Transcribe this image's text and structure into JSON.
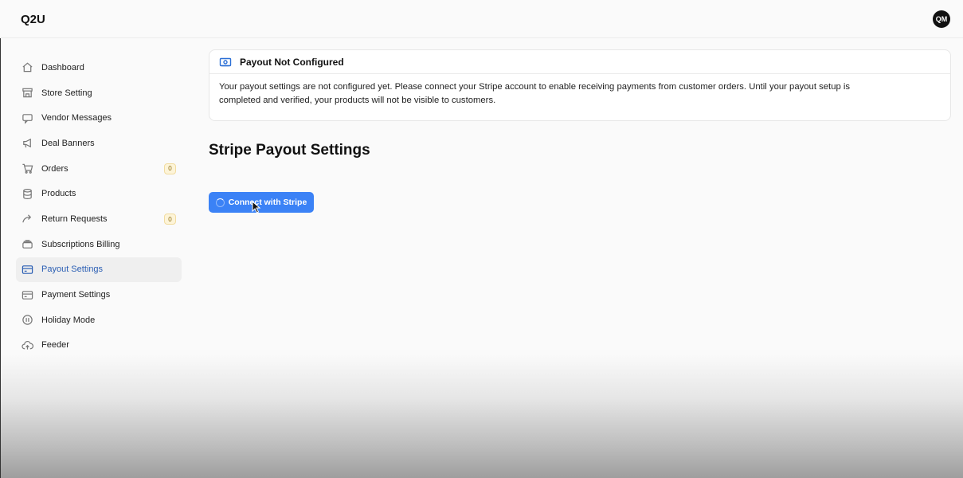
{
  "header": {
    "logo": "Q2U",
    "avatar_initials": "QM"
  },
  "sidebar": {
    "items": [
      {
        "label": "Dashboard",
        "icon": "home-icon",
        "badge": null,
        "active": false
      },
      {
        "label": "Store Setting",
        "icon": "store-icon",
        "badge": null,
        "active": false
      },
      {
        "label": "Vendor Messages",
        "icon": "message-icon",
        "badge": null,
        "active": false
      },
      {
        "label": "Deal Banners",
        "icon": "megaphone-icon",
        "badge": null,
        "active": false
      },
      {
        "label": "Orders",
        "icon": "cart-icon",
        "badge": "0",
        "active": false
      },
      {
        "label": "Products",
        "icon": "database-icon",
        "badge": null,
        "active": false
      },
      {
        "label": "Return Requests",
        "icon": "return-arrow-icon",
        "badge": "0",
        "active": false
      },
      {
        "label": "Subscriptions Billing",
        "icon": "archive-icon",
        "badge": null,
        "active": false
      },
      {
        "label": "Payout Settings",
        "icon": "card-icon",
        "badge": null,
        "active": true
      },
      {
        "label": "Payment Settings",
        "icon": "card-icon",
        "badge": null,
        "active": false
      },
      {
        "label": "Holiday Mode",
        "icon": "pause-icon",
        "badge": null,
        "active": false
      },
      {
        "label": "Feeder",
        "icon": "cloud-upload-icon",
        "badge": null,
        "active": false
      }
    ]
  },
  "alert": {
    "title": "Payout Not Configured",
    "icon": "banknote-icon",
    "body_line1": "Your payout settings are not configured yet. Please connect your Stripe account to enable receiving payments from customer orders. Until your payout setup is",
    "body_line2": "completed and verified, your products will not be visible to customers."
  },
  "main": {
    "title": "Stripe Payout Settings",
    "connect_button_label": "Connect with Stripe"
  },
  "colors": {
    "accent": "#3b82f6",
    "active_text": "#2b5fb4",
    "badge_bg": "#fdf4d8"
  }
}
